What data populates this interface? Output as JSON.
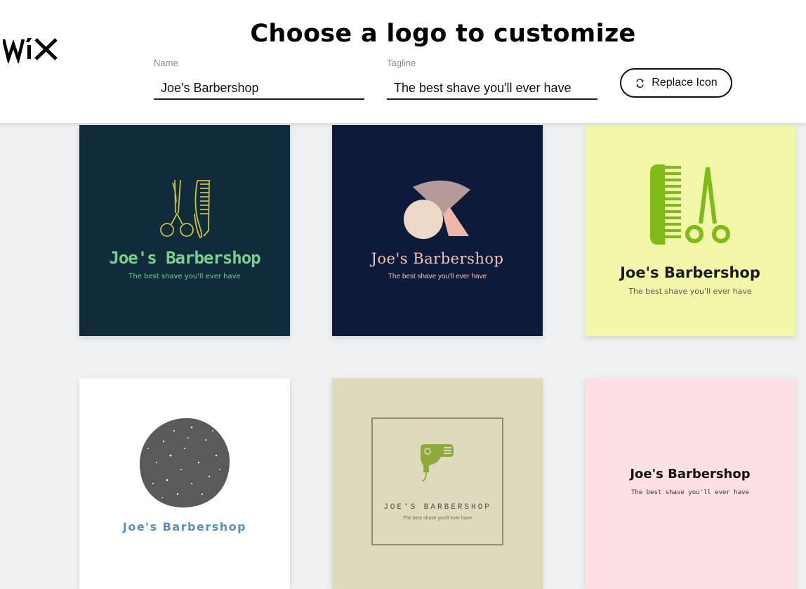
{
  "brand": {
    "logo_text": "WiX"
  },
  "header": {
    "title": "Choose a logo to customize",
    "name_label": "Name",
    "name_value": "Joe's Barbershop",
    "tagline_label": "Tagline",
    "tagline_value": "The best shave you'll ever have",
    "replace_button_label": "Replace Icon",
    "replace_icon": "swap-arrows-icon"
  },
  "logos": [
    {
      "name": "Joe's Barbershop",
      "tagline": "The best shave you'll ever have",
      "icon": "scissors-comb-icon",
      "background": "#0f2b3c",
      "name_color": "#79d08a",
      "tagline_color": "#79d08a",
      "icon_color": "#c8c33a"
    },
    {
      "name": "Joe's Barbershop",
      "tagline": "The best shave you'll ever have",
      "icon": "geometric-shapes-icon",
      "background": "#0d1a3a",
      "name_color": "#f0c4b4",
      "tagline_color": "#f0c4b4"
    },
    {
      "name": "Joe's Barbershop",
      "tagline": "The best shave you'll ever have",
      "icon": "comb-scissors-icon",
      "background": "#f3f8a8",
      "name_color": "#1b1b1b",
      "tagline_color": "#555555",
      "icon_color": "#7dba1a"
    },
    {
      "name": "Joe's Barbershop",
      "tagline": "",
      "icon": "speckled-circle-icon",
      "background": "#ffffff",
      "name_color": "#5b8fbf",
      "icon_color": "#5a5a5a"
    },
    {
      "name": "JOE'S BARBERSHOP",
      "tagline": "The best shave you'll ever have",
      "icon": "hair-dryer-icon",
      "background": "#dedbbb",
      "name_color": "#4f4f4f",
      "tagline_color": "#6a6a6a",
      "icon_color": "#8daa3a"
    },
    {
      "name": "Joe's Barbershop",
      "tagline": "The best shave you'll ever have",
      "icon": "",
      "background": "#fde0e3",
      "name_color": "#111111",
      "tagline_color": "#333333"
    }
  ]
}
